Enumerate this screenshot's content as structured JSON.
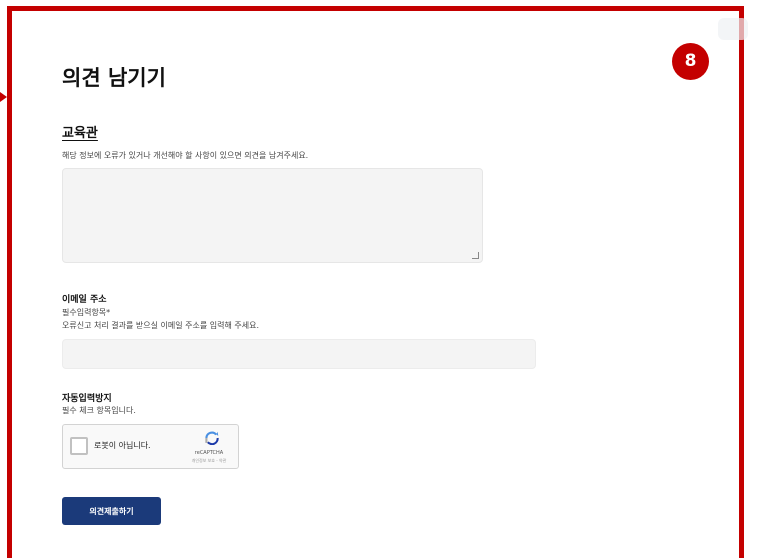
{
  "page": {
    "title": "의견 남기기",
    "badge": "8"
  },
  "section": {
    "title": "교육관",
    "help": "해당 정보에 오류가 있거나 개선해야 할 사항이 있으면 의견을 남겨주세요."
  },
  "email": {
    "label": "이메일 주소",
    "required": "필수입력항목*",
    "help": "오류신고 처리 결과를 받으실 이메일 주소를 입력해 주세요."
  },
  "captcha": {
    "label": "자동입력방지",
    "help": "필수 체크 항목입니다.",
    "checkbox_label": "로봇이 아닙니다.",
    "brand": "reCAPTCHA",
    "terms": "개인정보 보호 - 약관"
  },
  "submit": {
    "label": "의견제출하기"
  },
  "colors": {
    "frame": "#c40000",
    "button": "#1b3a7a"
  }
}
